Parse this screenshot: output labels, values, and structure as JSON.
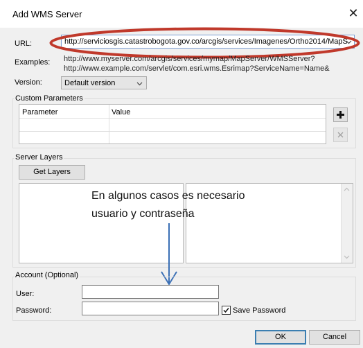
{
  "window": {
    "title": "Add WMS Server",
    "close": "✕"
  },
  "url": {
    "label": "URL:",
    "value": "http://serviciosgis.catastrobogota.gov.co/arcgis/services/Imagenes/Ortho2014/MapS"
  },
  "examples": {
    "label": "Examples:",
    "line1": "http://www.myserver.com/arcgis/services/mymap/MapServer/WMSServer?",
    "line2": "http://www.example.com/servlet/com.esri.wms.Esrimap?ServiceName=Name&"
  },
  "version": {
    "label": "Version:",
    "value": "Default version"
  },
  "custom_parameters": {
    "title": "Custom Parameters",
    "columns": [
      "Parameter",
      "Value"
    ],
    "add_icon": "plus-icon",
    "remove_icon": "close-icon"
  },
  "server_layers": {
    "title": "Server Layers",
    "get_layers": "Get Layers"
  },
  "annotation": {
    "line1": "En algunos casos es necesario",
    "line2": "usuario y contraseña",
    "ellipse_color": "#c0392b",
    "arrow_color": "#3a6fb5"
  },
  "account": {
    "title": "Account (Optional)",
    "user_label": "User:",
    "password_label": "Password:",
    "save_password": "Save Password",
    "save_password_checked": true
  },
  "buttons": {
    "ok": "OK",
    "cancel": "Cancel"
  }
}
